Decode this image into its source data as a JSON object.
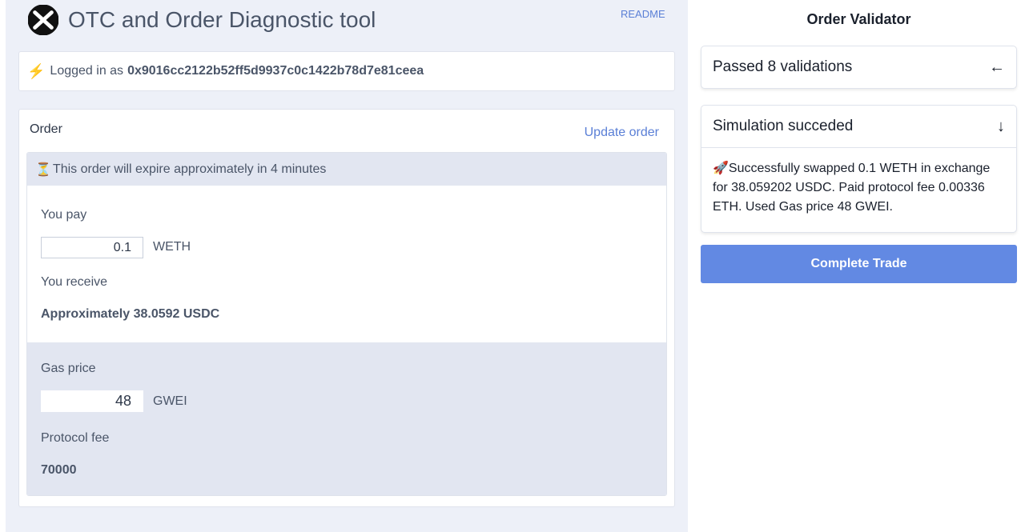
{
  "header": {
    "title": "OTC and Order Diagnostic tool",
    "readme_link": "README"
  },
  "login": {
    "icon": "lightning-bolt-icon",
    "prefix": "Logged in as",
    "address": "0x9016cc2122b52ff5d9937c0c1422b78d7e81ceea"
  },
  "order": {
    "title": "Order",
    "update_link": "Update order",
    "expiry_icon": "hourglass-icon",
    "expiry_text": "This order will expire approximately in 4 minutes",
    "you_pay_label": "You pay",
    "pay_amount": "0.1",
    "pay_token": "WETH",
    "you_receive_label": "You receive",
    "receive_text": "Approximately 38.0592 USDC",
    "gas_price_label": "Gas price",
    "gas_price_value": "48",
    "gas_unit": "GWEI",
    "protocol_fee_label": "Protocol fee",
    "protocol_fee_value": "70000"
  },
  "validator": {
    "title": "Order Validator",
    "validations_text": "Passed 8 validations",
    "validations_arrow": "←",
    "simulation_text": "Simulation succeded",
    "simulation_arrow": "↓",
    "simulation_icon": "rocket-icon",
    "simulation_detail": "Successfully swapped 0.1 WETH in exchange for 38.059202 USDC. Paid protocol fee 0.00336 ETH. Used Gas price 48 GWEI.",
    "complete_button": "Complete Trade"
  },
  "colors": {
    "accent": "#6289e3",
    "link": "#5a7fd6",
    "panel_bg": "#edf0f8",
    "section_gray": "#e2e6f1"
  }
}
